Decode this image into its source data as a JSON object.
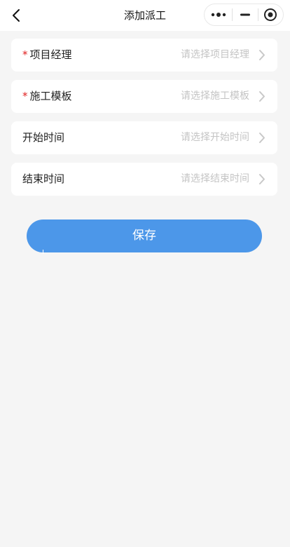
{
  "navbar": {
    "title": "添加派工",
    "back_icon": "chevron-left-icon",
    "capsule": {
      "more_icon": "more-dots-icon",
      "minimize_icon": "minimize-icon",
      "close_icon": "target-circle-icon"
    }
  },
  "form": {
    "items": [
      {
        "label": "项目经理",
        "required": true,
        "required_mark": "*",
        "placeholder": "请选择项目经理",
        "arrow_icon": "chevron-right-icon"
      },
      {
        "label": "施工模板",
        "required": true,
        "required_mark": "*",
        "placeholder": "请选择施工模板",
        "arrow_icon": "chevron-right-icon"
      },
      {
        "label": "开始时间",
        "required": false,
        "placeholder": "请选择开始时间",
        "arrow_icon": "chevron-right-icon"
      },
      {
        "label": "结束时间",
        "required": false,
        "placeholder": "请选择结束时间",
        "arrow_icon": "chevron-right-icon"
      }
    ]
  },
  "actions": {
    "save_label": "保存"
  },
  "colors": {
    "background": "#f5f5f5",
    "card": "#ffffff",
    "primary": "#4c97e9",
    "required": "#e02020",
    "placeholder": "#c4c4c4",
    "label": "#222222"
  }
}
